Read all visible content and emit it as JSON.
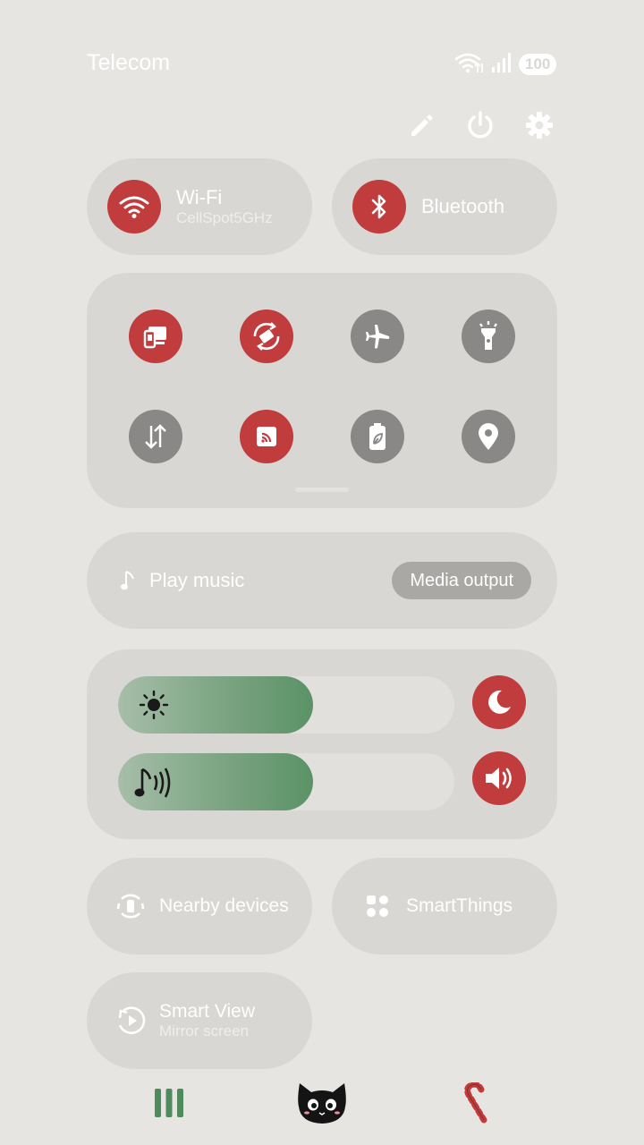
{
  "status": {
    "carrier": "Telecom",
    "battery": "100"
  },
  "tiles": {
    "wifi": {
      "label": "Wi-Fi",
      "network": "CellSpot5GHz"
    },
    "bluetooth": {
      "label": "Bluetooth"
    }
  },
  "quick_toggles": [
    {
      "icon": "smart-view-devices-icon",
      "state": "on"
    },
    {
      "icon": "auto-rotate-icon",
      "state": "on"
    },
    {
      "icon": "airplane-icon",
      "state": "off"
    },
    {
      "icon": "flashlight-icon",
      "state": "off"
    },
    {
      "icon": "mobile-data-icon",
      "state": "off"
    },
    {
      "icon": "nfc-icon",
      "state": "on"
    },
    {
      "icon": "power-saving-icon",
      "state": "off"
    },
    {
      "icon": "location-icon",
      "state": "off"
    }
  ],
  "media": {
    "label": "Play music",
    "output_button": "Media output"
  },
  "sliders": {
    "brightness_level": 0.58,
    "volume_level": 0.58
  },
  "shortcuts": {
    "nearby": "Nearby devices",
    "smartthings": "SmartThings",
    "smartview_title": "Smart View",
    "smartview_sub": "Mirror screen"
  },
  "colors": {
    "accent_red": "#c13c3d",
    "inactive_grey": "#898886",
    "slider_green": "#5b9266",
    "background": "#e6e5e1"
  }
}
